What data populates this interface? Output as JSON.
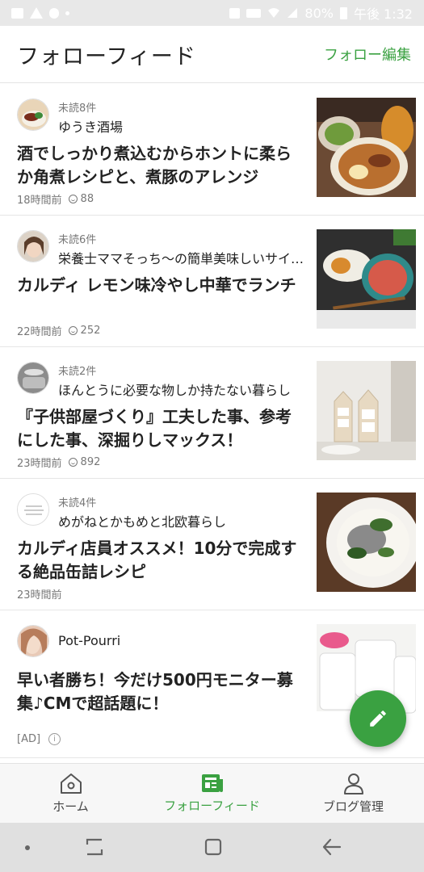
{
  "status_bar": {
    "battery": "80%",
    "time": "午後 1:32",
    "icons": [
      "image-icon",
      "warning-icon",
      "wifi-call-icon",
      "dot-icon",
      "mute-icon",
      "nfc-icon",
      "wifi-icon",
      "signal-icon",
      "battery-icon"
    ]
  },
  "header": {
    "title": "フォローフィード",
    "edit_label": "フォロー編集"
  },
  "feed": [
    {
      "unread": "未読8件",
      "blog": "ゆうき酒場",
      "title": "酒でしっかり煮込むからホントに柔らか角煮レシピと、煮豚のアレンジ",
      "time": "18時間前",
      "count": "88"
    },
    {
      "unread": "未読6件",
      "blog": "栄養士ママそっち～の簡単美味しいサイドメニュー",
      "title": "カルディ レモン味冷やし中華でランチ",
      "time": "22時間前",
      "count": "252"
    },
    {
      "unread": "未読2件",
      "blog": "ほんとうに必要な物しか持たない暮らし",
      "title": "『子供部屋づくり』工夫した事、参考にした事、深掘りしマックス！",
      "time": "23時間前",
      "count": "892"
    },
    {
      "unread": "未読4件",
      "blog": "めがねとかもめと北欧暮らし",
      "title": "カルディ店員オススメ！10分で完成する絶品缶詰レシピ",
      "time": "23時間前"
    },
    {
      "blog": "Pot-Pourri",
      "title": "早い者勝ち！今だけ500円モニター募集♪CMで超話題に！",
      "ad": "[AD]"
    }
  ],
  "bottom_nav": {
    "home": "ホーム",
    "feed": "フォローフィード",
    "blog": "ブログ管理"
  },
  "colors": {
    "accent": "#3aa141"
  }
}
